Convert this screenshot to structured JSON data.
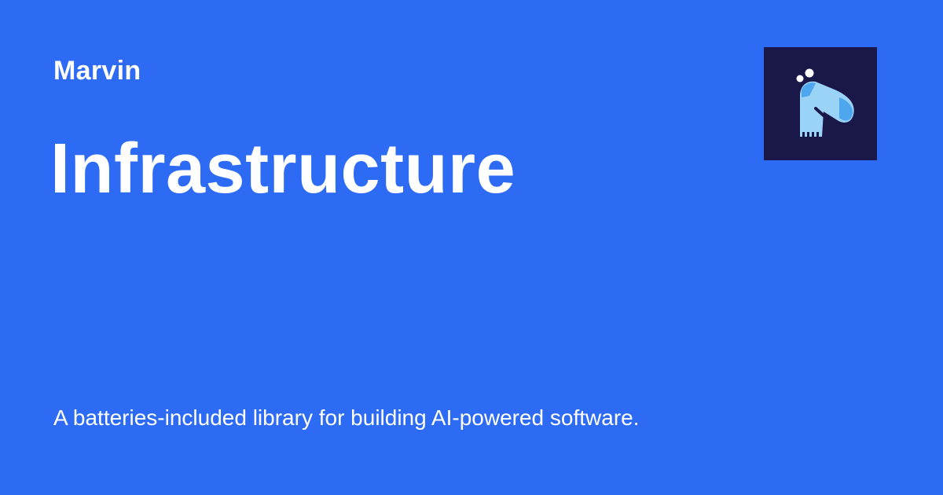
{
  "site": {
    "name": "Marvin"
  },
  "page": {
    "title": "Infrastructure",
    "description": "A batteries-included library for building AI-powered software."
  },
  "logo": {
    "icon": "marvin-robot-logo-icon",
    "background": "#1a1848",
    "primary_color": "#9bd3f7",
    "accent_color": "#5bb0f0"
  },
  "colors": {
    "background": "#2d6bf5",
    "text": "#ffffff"
  }
}
